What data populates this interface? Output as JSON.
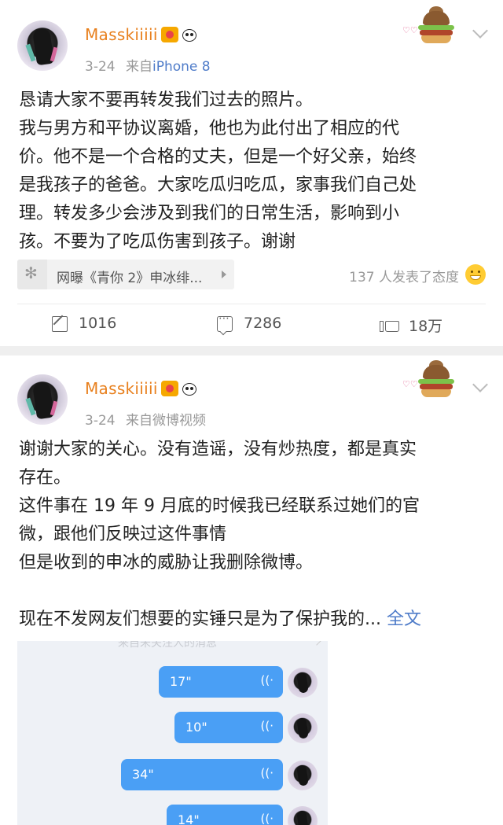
{
  "posts": [
    {
      "username": "Masskiiiii",
      "date": "3-24",
      "source_prefix": "来自",
      "source": "iPhone 8",
      "text_lines": [
        "恳请大家不要再转发我们过去的照片。",
        "我与男方和平协议离婚，他也为此付出了相应的代",
        "价。他不是一个合格的丈夫，但是一个好父亲，始终",
        "是我孩子的爸爸。大家吃瓜归吃瓜，家事我们自己处",
        "理。转发多少会涉及到我们的日常生活，影响到小",
        "孩。不要为了吃瓜伤害到孩子。谢谢"
      ],
      "topic": "网曝《青你 2》申冰绯...",
      "reactions": "137 人发表了态度",
      "reposts": "1016",
      "comments": "7286",
      "likes": "18万"
    },
    {
      "username": "Masskiiiii",
      "date": "3-24",
      "source_prefix": "来自微博视频",
      "source": "",
      "text_lines": [
        "谢谢大家的关心。没有造谣，没有炒热度，都是真实",
        "存在。",
        "这件事在 19 年 9 月底的时候我已经联系过她们的官",
        "微，跟他们反映过这件事情",
        "但是收到的申冰的威胁让我删除微博。",
        "",
        "现在不发网友们想要的实锤只是为了保护我的..."
      ],
      "full_text_link": "全文",
      "chat_image": {
        "header": "来自未关注人的消息",
        "voice_messages": [
          "17\"",
          "10\"",
          "34\"",
          "14\""
        ],
        "wave_glyph": "((·"
      }
    }
  ],
  "icons": {
    "repost": "repost-icon",
    "comment": "comment-icon",
    "like": "like-icon",
    "topic": "topic-icon",
    "reaction": "smiley-icon",
    "more": "chevron-down-icon"
  },
  "colors": {
    "username": "#e8801e",
    "link": "#4f7cc9",
    "meta": "#999999",
    "bubble": "#4a9ff5"
  }
}
